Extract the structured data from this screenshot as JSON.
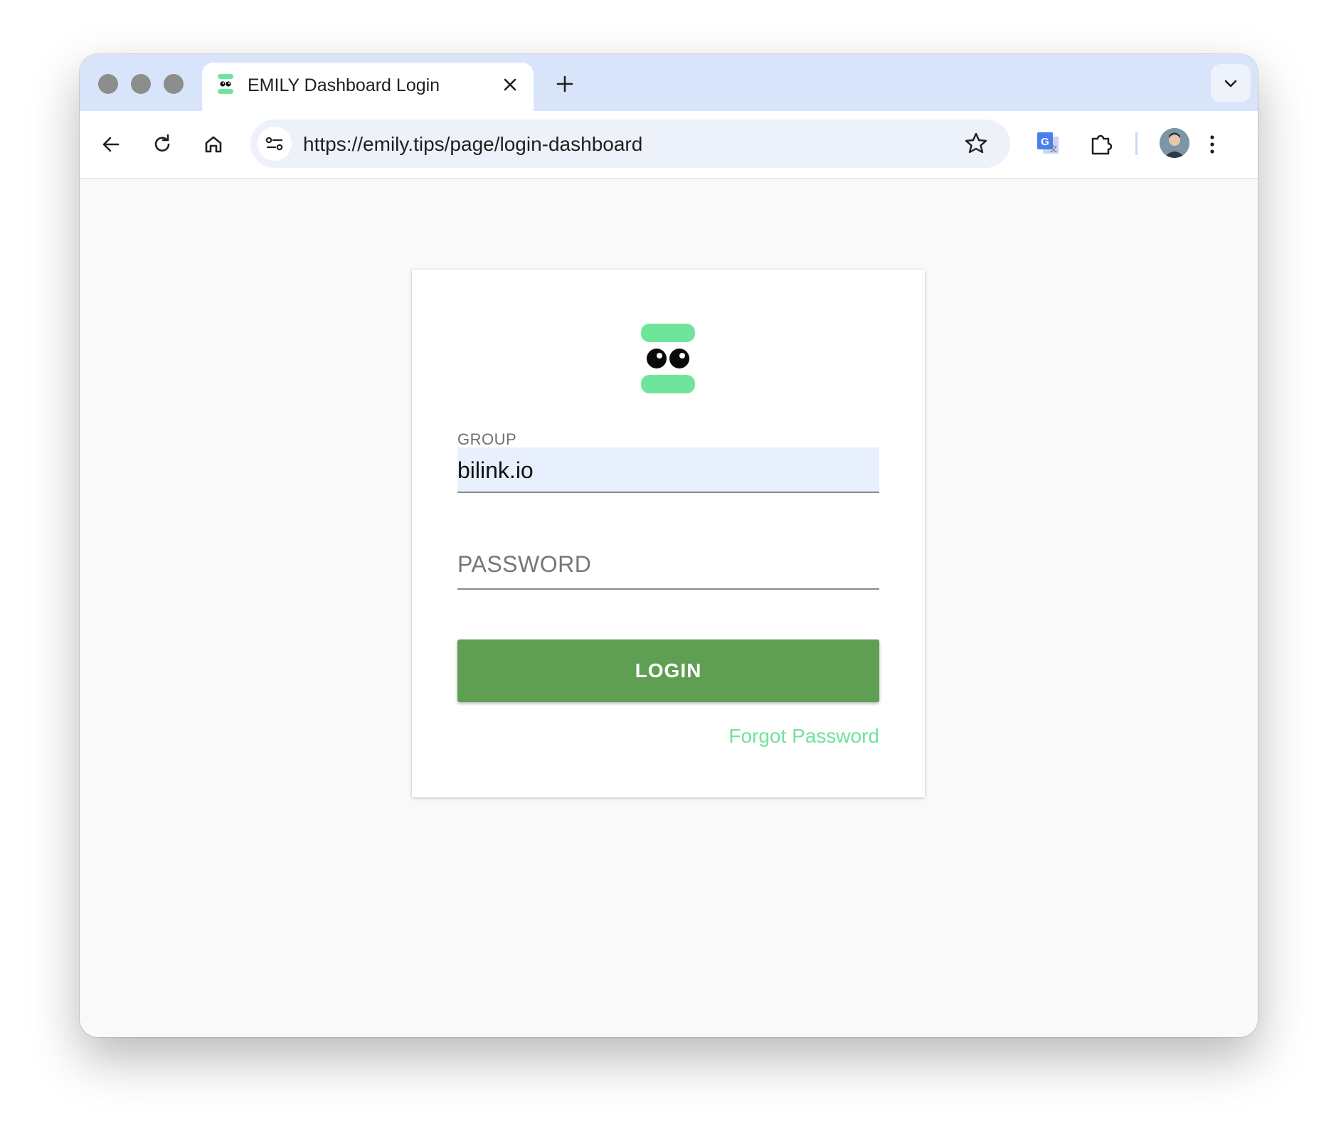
{
  "browser": {
    "tab_title": "EMILY Dashboard Login",
    "url": "https://emily.tips/page/login-dashboard"
  },
  "login_form": {
    "group_label": "GROUP",
    "group_value": "bilink.io",
    "password_placeholder": "PASSWORD",
    "login_label": "LOGIN",
    "forgot_label": "Forgot Password"
  },
  "colors": {
    "brand_green": "#6ee59a",
    "login_button": "#5f9f54",
    "link": "#6fe39b",
    "autofill_bg": "#e8f0fe"
  },
  "icons": [
    "back-arrow-icon",
    "reload-icon",
    "home-icon",
    "site-info-icon",
    "star-icon",
    "translate-icon",
    "extensions-icon",
    "kebab-menu-icon",
    "chevron-down-icon",
    "close-icon",
    "plus-icon"
  ]
}
